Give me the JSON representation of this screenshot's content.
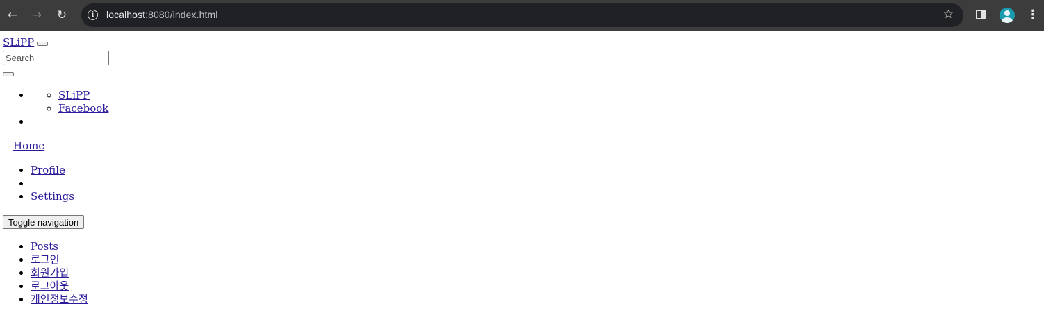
{
  "browser": {
    "url_host": "localhost",
    "url_rest": ":8080/index.html",
    "icons": [
      "back-icon",
      "forward-icon",
      "reload-icon",
      "info-icon",
      "star-icon",
      "side-panel-icon",
      "profile-avatar",
      "menu-icon"
    ]
  },
  "navbar": {
    "brand": "SLiPP",
    "search_placeholder": "Search"
  },
  "dropdown": {
    "items": [
      "SLiPP",
      "Facebook"
    ]
  },
  "home_link": "Home",
  "user_menu": {
    "profile": "Profile",
    "settings": "Settings"
  },
  "toggle_label": "Toggle navigation",
  "main_nav": [
    "Posts",
    "로그인",
    "회원가입",
    "로그아웃",
    "개인정보수정"
  ],
  "colors": {
    "chrome_bg": "#3c3c3c",
    "omnibox_bg": "#202124",
    "link": "#2a1b9a"
  }
}
